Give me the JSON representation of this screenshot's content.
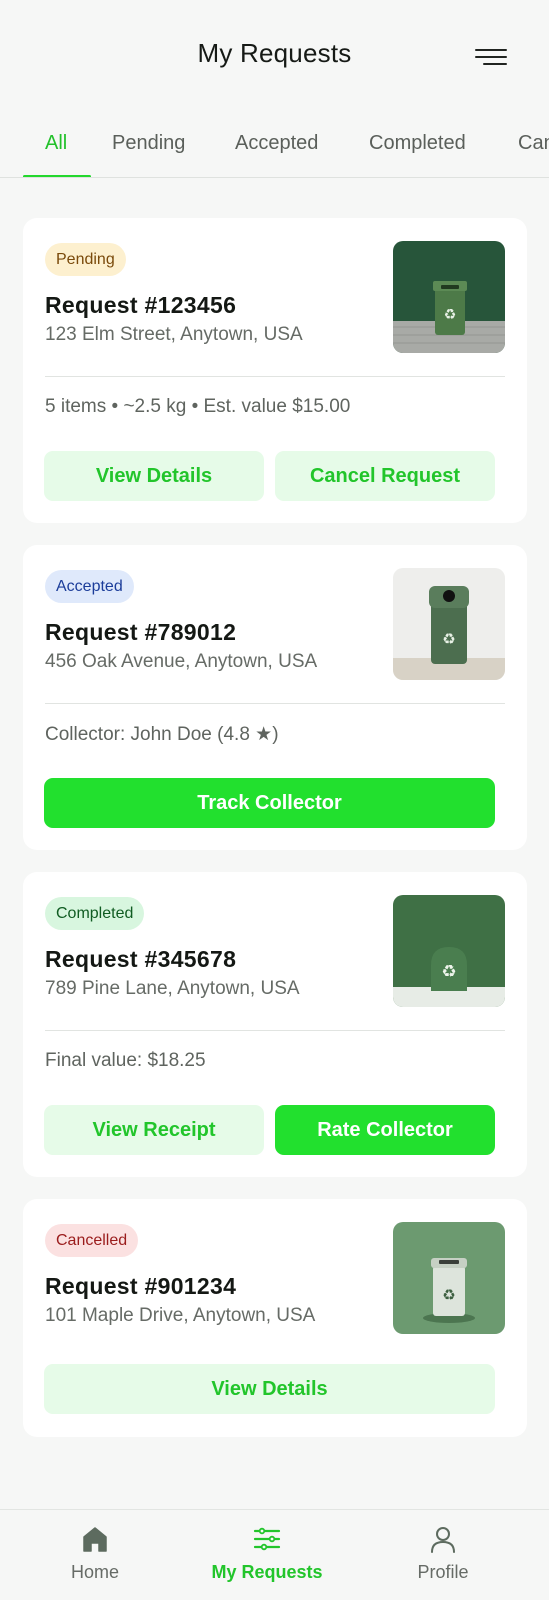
{
  "header": {
    "title": "My Requests",
    "menu_icon": "hamburger-menu-icon"
  },
  "tabs": [
    {
      "label": "All",
      "active": true
    },
    {
      "label": "Pending",
      "active": false
    },
    {
      "label": "Accepted",
      "active": false
    },
    {
      "label": "Completed",
      "active": false
    },
    {
      "label": "Cancelled",
      "active": false
    }
  ],
  "requests": [
    {
      "status": "Pending",
      "title": "Request #123456",
      "address": "123 Elm Street, Anytown, USA",
      "meta": "5 items • ~2.5 kg • Est. value $15.00",
      "buttons": [
        "View Details",
        "Cancel Request"
      ]
    },
    {
      "status": "Accepted",
      "title": "Request #789012",
      "address": "456 Oak Avenue, Anytown, USA",
      "meta": "Collector: John Doe (4.8 ★)",
      "buttons": [
        "Track Collector"
      ]
    },
    {
      "status": "Completed",
      "title": "Request #345678",
      "address": "789 Pine Lane, Anytown, USA",
      "meta": "Final value: $18.25",
      "buttons": [
        "View Receipt",
        "Rate Collector"
      ]
    },
    {
      "status": "Cancelled",
      "title": "Request #901234",
      "address": "101 Maple Drive, Anytown, USA",
      "buttons": [
        "View Details"
      ]
    }
  ],
  "nav": {
    "items": [
      {
        "label": "Home",
        "icon": "home-icon",
        "active": false
      },
      {
        "label": "My Requests",
        "icon": "list-icon",
        "active": true
      },
      {
        "label": "Profile",
        "icon": "user-icon",
        "active": false
      }
    ]
  },
  "colors": {
    "accent": "#22e02e",
    "accent_text": "#22c52b",
    "accent_soft": "#e6fbe8"
  }
}
